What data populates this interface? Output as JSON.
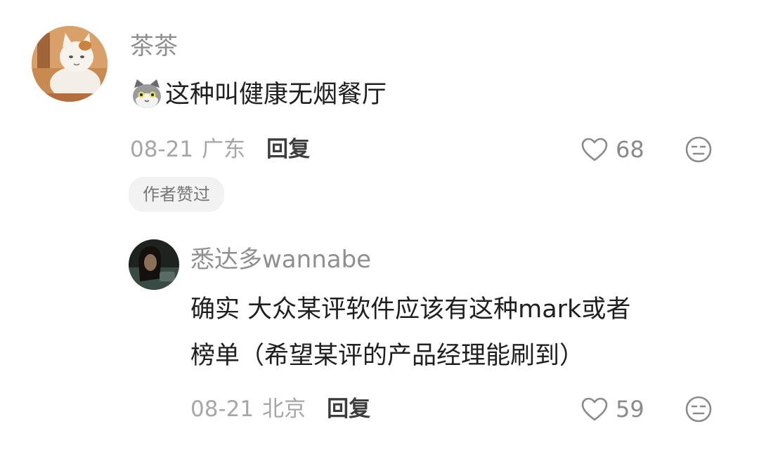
{
  "comments": [
    {
      "username": "茶茶",
      "emoji_icon": "cat-face-icon",
      "text": "这种叫健康无烟餐厅",
      "date": "08-21",
      "location": "广东",
      "reply_label": "回复",
      "like_count": "68",
      "badge": "作者赞过"
    }
  ],
  "replies": [
    {
      "username": "悉达多wannabe",
      "text_line1": "确实 大众某评软件应该有这种mark或者",
      "text_line2": "榜单（希望某评的产品经理能刷到）",
      "date": "08-21",
      "location": "北京",
      "reply_label": "回复",
      "like_count": "59"
    }
  ],
  "icons": {
    "like": "heart-outline-icon",
    "dislike": "neutral-face-icon"
  },
  "colors": {
    "username": "#8f8f8f",
    "meta": "#a6a6a6",
    "badge_bg": "#f2f2f2"
  }
}
